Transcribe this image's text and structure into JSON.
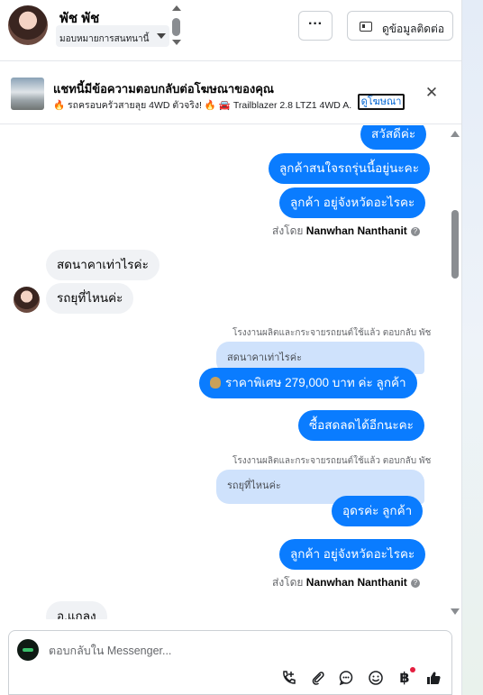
{
  "header": {
    "contact_name": "พัช พัช",
    "assign_label": "มอบหมายการสนทนานี้",
    "more_label": "···",
    "contact_button_label": "ดูข้อมูลติดต่อ"
  },
  "ad_banner": {
    "title": "แชทนี้มีข้อความตอบกลับต่อโฆษณาของคุณ",
    "subtitle": "🔥 รถครอบครัวสายลุย 4WD ตัวจริง! 🔥 🚘 Trailblazer 2.8 LTZ1 4WD A...",
    "link_label": "ดูโฆษณา",
    "close_label": "✕"
  },
  "messages": {
    "out_1": "สวัสดีค่ะ",
    "out_2": "ลูกค้าสนใจรถรุ่นนี้อยู่นะคะ",
    "out_3": "ลูกค้า อยู่จังหวัดอะไรคะ",
    "sent_by_prefix": "ส่งโดย",
    "sent_by_name": "Nanwhan Nanthanit",
    "in_1": "สดนาคาเท่าไรค่ะ",
    "in_2": "รถยุที่ไหนค่ะ",
    "reply_meta_1": "โรงงานผลิตและกระจายรถยนต์ใช้แล้ว ตอบกลับ พัช",
    "quoted_1": "สดนาคาเท่าไรค่ะ",
    "out_4": "ราคาพิเศษ 279,000 บาท ค่ะ  ลูกค้า",
    "out_5": "ซื้อสดลดได้อีกนะคะ",
    "reply_meta_2": "โรงงานผลิตและกระจายรถยนต์ใช้แล้ว ตอบกลับ พัช",
    "quoted_2": "รถยุที่ไหนค่ะ",
    "out_6": "อุดรค่ะ  ลูกค้า",
    "out_7": "ลูกค้า อยู่จังหวัดอะไรคะ",
    "in_3": "อ.แกลง"
  },
  "composer": {
    "placeholder": "ตอบกลับใน Messenger..."
  },
  "icons": [
    "contact-card-icon",
    "close-icon",
    "phone-plus-icon",
    "paperclip-icon",
    "chat-bubble-icon",
    "emoji-icon",
    "baht-icon",
    "thumbs-up-icon",
    "money-bag-icon"
  ],
  "colors": {
    "outgoing_bubble": "#0a7cff",
    "incoming_bubble": "#f0f2f5",
    "quoted_bubble": "#cfe2fc"
  }
}
